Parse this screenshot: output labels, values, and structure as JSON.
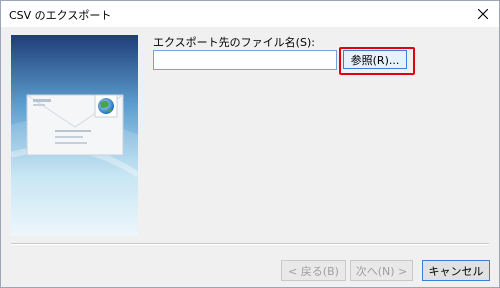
{
  "window": {
    "title": "CSV のエクスポート",
    "close_icon": "close-icon"
  },
  "side_panel": {
    "illustration": "envelope-with-globe-stamp",
    "colors": {
      "top": "#1f3d78",
      "bottom": "#e8f4fb"
    }
  },
  "form": {
    "filename_label": "エクスポート先のファイル名(S):",
    "filename_value": "",
    "filename_placeholder": "",
    "browse_label": "参照(R)..."
  },
  "buttons": {
    "back_label": "< 戻る(B)",
    "next_label": "次へ(N) >",
    "cancel_label": "キャンセル"
  },
  "colors": {
    "highlight": "#e0000f",
    "focus_border": "#3c7fd8"
  }
}
